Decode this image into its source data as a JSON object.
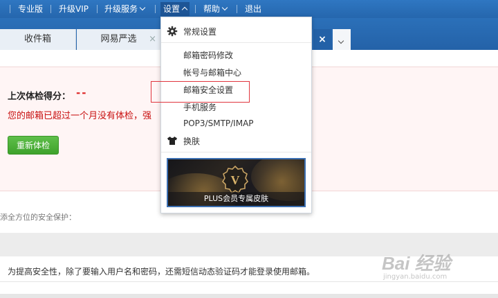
{
  "topnav": {
    "items": [
      {
        "label": "专业版"
      },
      {
        "label": "升级VIP"
      },
      {
        "label": "升级服务"
      },
      {
        "label": "设置"
      },
      {
        "label": "帮助"
      },
      {
        "label": "退出"
      }
    ]
  },
  "tabs": [
    {
      "label": "收件箱"
    },
    {
      "label": "网易严选",
      "close": "×"
    }
  ],
  "tab_close_active": "×",
  "checkup": {
    "score_label": "上次体检得分：",
    "score_value": "--",
    "warning": "您的邮箱已超过一个月没有体检，强",
    "recheck_button": "重新体检"
  },
  "protect_text": "添全方位的安全保护：",
  "sms_note": "为提高安全性，除了要输入用户名和密码，还需短信动态验证码才能登录使用邮箱。",
  "dropdown": {
    "items": [
      {
        "label": "常规设置",
        "icon": "gear-icon"
      },
      {
        "label": "邮箱密码修改"
      },
      {
        "label": "帐号与邮箱中心"
      },
      {
        "label": "邮箱安全设置"
      },
      {
        "label": "手机服务"
      },
      {
        "label": "POP3/SMTP/IMAP"
      },
      {
        "label": "换肤",
        "icon": "shirt-icon"
      }
    ],
    "banner_caption": "PLUS会员专属皮肤",
    "banner_badge": "V"
  },
  "watermark": {
    "text": "Bai 经验",
    "sub": "jingyan.baidu.com"
  },
  "colors": {
    "nav_blue": "#2a6db5",
    "warn_red": "#c81010",
    "button_green": "#3ea22b",
    "highlight_red": "#e0353d"
  }
}
